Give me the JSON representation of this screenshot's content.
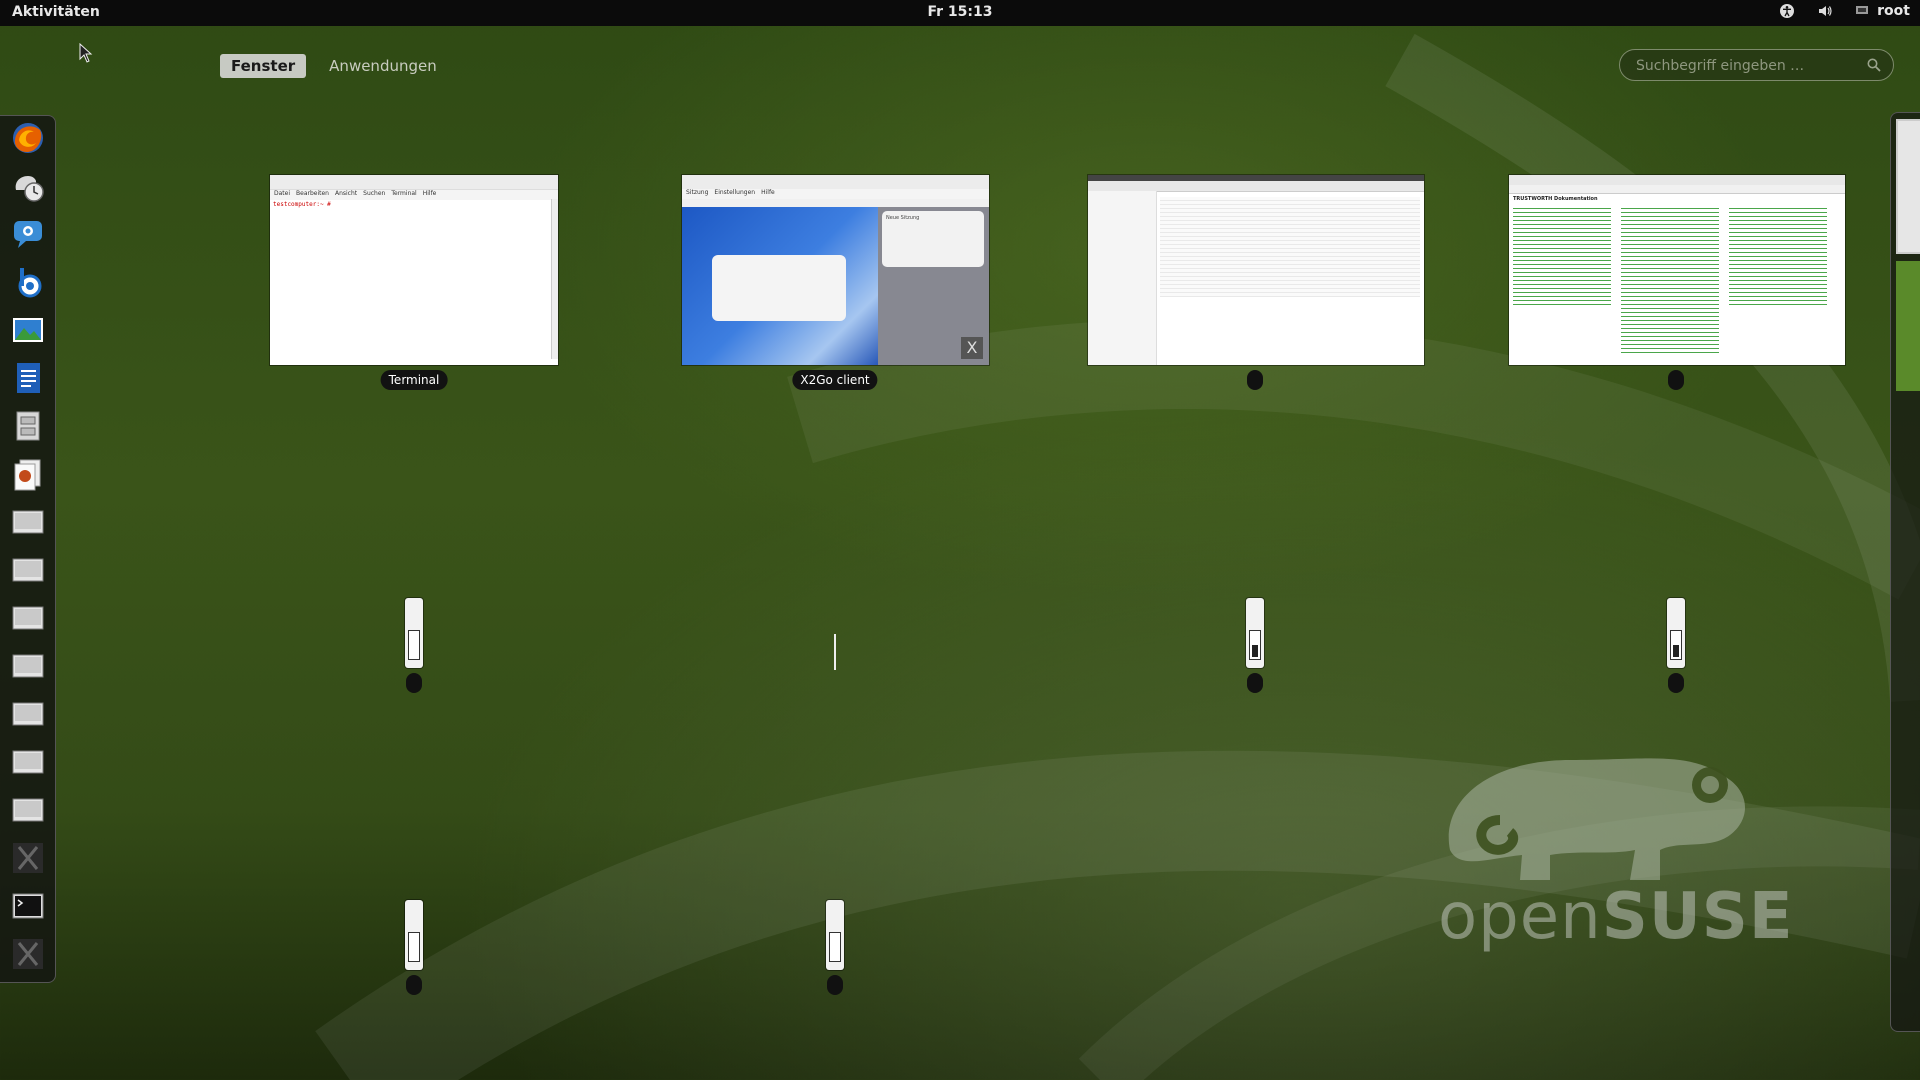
{
  "topbar": {
    "activities_label": "Aktivitäten",
    "clock": "Fr 15:13",
    "user": "root",
    "icons": [
      "accessibility-icon",
      "volume-icon",
      "user-icon"
    ]
  },
  "view_tabs": [
    {
      "label": "Fenster",
      "active": true
    },
    {
      "label": "Anwendungen",
      "active": false
    }
  ],
  "search": {
    "placeholder": "Suchbegriff eingeben …"
  },
  "dash": {
    "items": [
      "firefox-icon",
      "software-update-icon",
      "chat-icon",
      "bluetooth-icon",
      "image-viewer-icon",
      "writer-icon",
      "file-cabinet-icon",
      "document-viewer-icon",
      "window-icon",
      "window-icon",
      "window-icon",
      "window-icon",
      "window-icon",
      "window-icon",
      "window-icon",
      "x11-icon",
      "terminal-icon",
      "x11-icon"
    ]
  },
  "windows": [
    {
      "title": "Terminal",
      "menu": [
        "Datei",
        "Bearbeiten",
        "Ansicht",
        "Suchen",
        "Terminal",
        "Hilfe"
      ],
      "prompt": "testcomputer:~ #"
    },
    {
      "title": "X2Go client",
      "menu": [
        "Sitzung",
        "Einstellungen",
        "Hilfe"
      ],
      "session_card": "Neue Sitzung"
    },
    {
      "title": ""
    },
    {
      "title": "",
      "page_heading": "TRUSTWORTH Dokumentation"
    }
  ],
  "workspace": {
    "current": 1
  },
  "branding": {
    "logo_light": "open",
    "logo_bold": "SUSE"
  }
}
